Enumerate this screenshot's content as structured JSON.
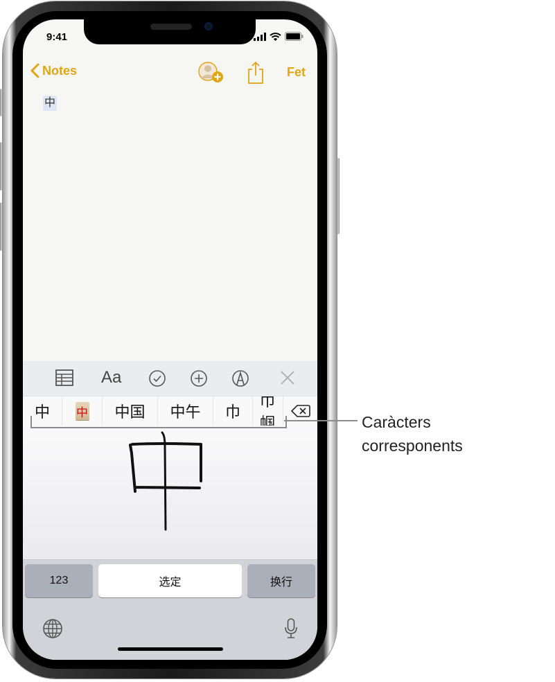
{
  "status_bar": {
    "time": "9:41",
    "icons": [
      "cellular-signal-icon",
      "wifi-icon",
      "battery-icon"
    ]
  },
  "nav": {
    "back_label": "Notes",
    "add_person_icon": "person-add-icon",
    "share_icon": "share-icon",
    "done_label": "Fet",
    "accent_color": "#e1a513"
  },
  "note": {
    "content": "中"
  },
  "format_toolbar": {
    "items": [
      {
        "name": "table",
        "icon": "table-icon"
      },
      {
        "name": "text-style",
        "label": "Aa"
      },
      {
        "name": "checklist",
        "icon": "checkmark-circle-icon"
      },
      {
        "name": "insert",
        "icon": "plus-circle-icon"
      },
      {
        "name": "markup",
        "icon": "markup-pen-icon"
      },
      {
        "name": "close",
        "icon": "close-icon"
      }
    ]
  },
  "candidates": {
    "items": [
      "中",
      "中",
      "中国",
      "中午",
      "巾",
      "巾帼"
    ],
    "tile_item_index": 1,
    "delete_icon": "delete-backspace-icon"
  },
  "handwriting": {
    "stroke_character": "中"
  },
  "keyboard": {
    "numbers_key": "123",
    "select_key": "选定",
    "return_key": "换行",
    "globe_icon": "globe-icon",
    "mic_icon": "microphone-icon"
  },
  "callout": {
    "line1": "Caràcters",
    "line2": "corresponents"
  }
}
